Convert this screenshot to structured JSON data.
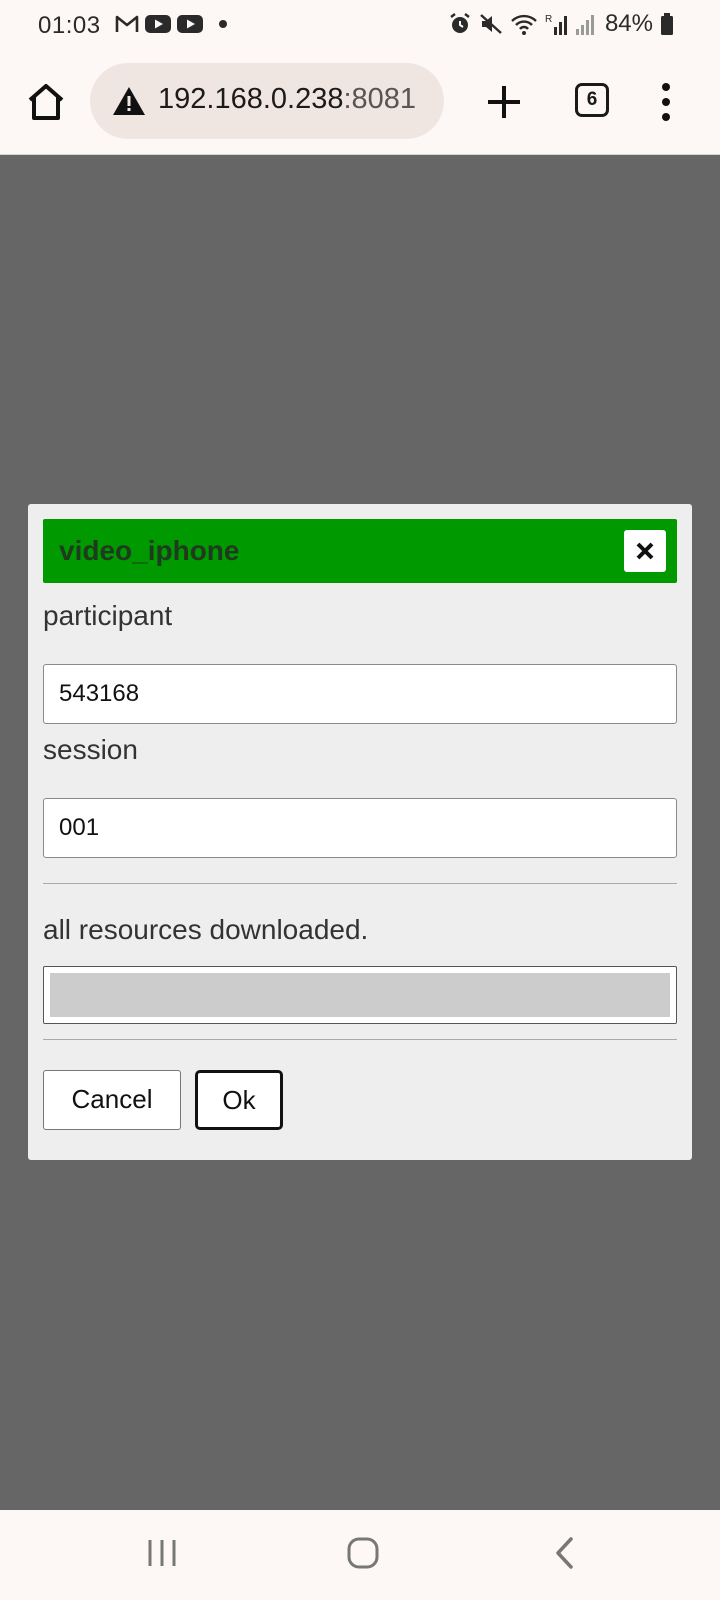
{
  "status_bar": {
    "time": "01:03",
    "battery": "84%",
    "left_icons": [
      "gmail-icon",
      "youtube-icon",
      "youtube-icon",
      "notification-dot-icon"
    ],
    "right_icons": [
      "alarm-icon",
      "mute-icon",
      "wifi-icon",
      "signal-icon",
      "signal-icon",
      "battery-icon"
    ]
  },
  "browser": {
    "url_host": "192.168.0.238",
    "url_port": ":8081",
    "tab_count": "6",
    "security_icon": "warning-icon"
  },
  "dialog": {
    "title": "video_iphone",
    "header_color": "#009900",
    "fields": [
      {
        "label": "participant",
        "value": "543168"
      },
      {
        "label": "session",
        "value": "001"
      }
    ],
    "status": "all resources downloaded.",
    "progress": 1.0,
    "buttons": {
      "cancel": "Cancel",
      "ok": "Ok"
    }
  },
  "nav_bar": {
    "icons": [
      "recent-apps-icon",
      "home-icon",
      "back-icon"
    ]
  }
}
